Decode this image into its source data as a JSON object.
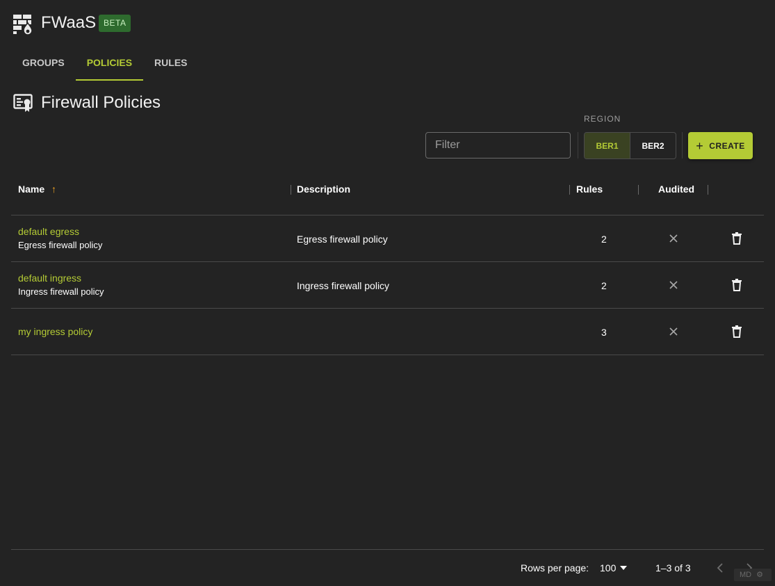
{
  "header": {
    "app_title": "FWaaS",
    "badge": "BETA",
    "logo_icon": "firewall-icon"
  },
  "tabs": [
    {
      "label": "GROUPS",
      "active": false
    },
    {
      "label": "POLICIES",
      "active": true
    },
    {
      "label": "RULES",
      "active": false
    }
  ],
  "page": {
    "title": "Firewall Policies",
    "title_icon": "policy-certificate-icon"
  },
  "toolbar": {
    "filter_placeholder": "Filter",
    "filter_value": "",
    "region_label": "REGION",
    "regions": [
      {
        "label": "BER1",
        "selected": true
      },
      {
        "label": "BER2",
        "selected": false
      }
    ],
    "create_label": "CREATE"
  },
  "table": {
    "columns": [
      "Name",
      "Description",
      "Rules",
      "Audited"
    ],
    "sort_indicator": "↑",
    "rows": [
      {
        "name": "default egress",
        "subtitle": "Egress firewall policy",
        "description": "Egress firewall policy",
        "rules": "2",
        "audited": false
      },
      {
        "name": "default ingress",
        "subtitle": "Ingress firewall policy",
        "description": "Ingress firewall policy",
        "rules": "2",
        "audited": false
      },
      {
        "name": "my ingress policy",
        "subtitle": "",
        "description": "",
        "rules": "3",
        "audited": false
      }
    ]
  },
  "footer": {
    "rows_per_page_label": "Rows per page:",
    "rows_per_page_value": "100",
    "range": "1–3 of 3",
    "md_badge": "MD"
  },
  "colors": {
    "accent": "#b4cb35",
    "background": "#232323",
    "badge_bg": "#2e6b2e",
    "sort_arrow": "#f5a623"
  }
}
